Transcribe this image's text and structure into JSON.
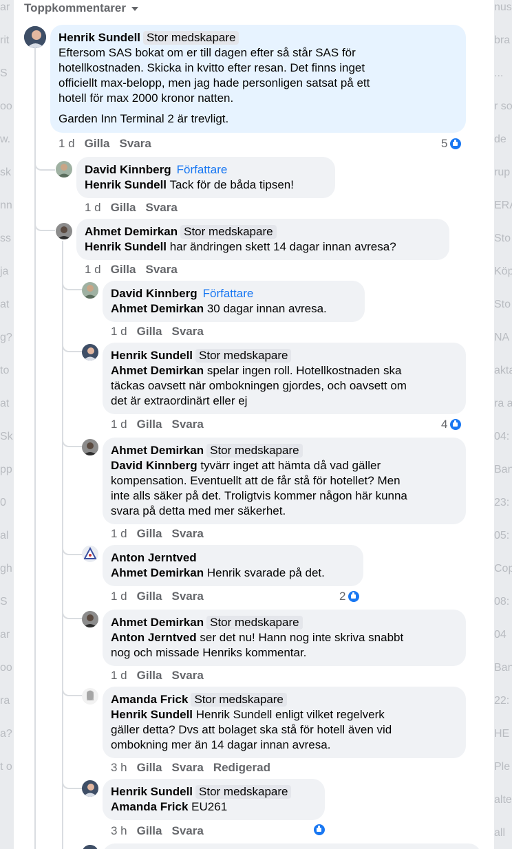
{
  "background_left": [
    "ar",
    "rit",
    "S",
    "oo",
    "w.",
    "sk",
    "nn",
    "ss",
    "ja",
    "at",
    "g?",
    "to",
    "at",
    "Sk",
    "pp",
    "0",
    "al",
    "gh",
    "S",
    "ar",
    "oo",
    "ra",
    "a?",
    "t o"
  ],
  "background_right": [
    "nus",
    "bra",
    "...",
    "r so",
    "de",
    "rup",
    "ERA",
    "Sto",
    "Köp",
    "Sto",
    "NA",
    "akta",
    "ra am",
    "04:",
    "Ban",
    "23:",
    "05:",
    "Cop",
    "08:",
    "04",
    "Ban",
    "22:",
    "HE",
    "Ple",
    "alte",
    "all"
  ],
  "sort": {
    "label": "Toppkommentarer"
  },
  "comments": [
    {
      "author": "Henrik Sundell",
      "badge": "Stor medskapare",
      "text_lines": [
        "Eftersom SAS bokat om er till dagen efter så står SAS för",
        "hotellkostnaden. Skicka in kvitto efter resan. Det finns inget",
        "officiellt max-belopp, men jag hade personligen satsat på ett",
        "hotell för max 2000 kronor natten."
      ],
      "text2": "Garden Inn Terminal 2 är trevligt.",
      "time": "1 d",
      "like": "Gilla",
      "reply": "Svara",
      "likes": "5"
    },
    {
      "author": "David Kinnberg",
      "badge": "Författare",
      "mention": "Henrik Sundell",
      "text": "Tack för de båda tipsen!",
      "time": "1 d",
      "like": "Gilla",
      "reply": "Svara"
    },
    {
      "author": "Ahmet Demirkan",
      "badge": "Stor medskapare",
      "mention": "Henrik Sundell",
      "text": "har ändringen skett 14 dagar innan avresa?",
      "time": "1 d",
      "like": "Gilla",
      "reply": "Svara"
    },
    {
      "author": "David Kinnberg",
      "badge": "Författare",
      "mention": "Ahmet Demirkan",
      "text": "30 dagar innan avresa.",
      "time": "1 d",
      "like": "Gilla",
      "reply": "Svara"
    },
    {
      "author": "Henrik Sundell",
      "badge": "Stor medskapare",
      "mention": "Ahmet Demirkan",
      "text": "spelar ingen roll. Hotellkostnaden ska",
      "text_lines": [
        "täckas oavsett när ombokningen gjordes, och oavsett om",
        "det är extraordinärt eller ej"
      ],
      "time": "1 d",
      "like": "Gilla",
      "reply": "Svara",
      "likes": "4"
    },
    {
      "author": "Ahmet Demirkan",
      "badge": "Stor medskapare",
      "mention": "David Kinnberg",
      "text": "tyvärr inget att hämta då vad gäller",
      "text_lines": [
        "kompensation. Eventuellt att de får stå för hotellet? Men",
        "inte alls säker på det. Troligtvis kommer någon här kunna",
        "svara på detta med mer säkerhet."
      ],
      "time": "1 d",
      "like": "Gilla",
      "reply": "Svara"
    },
    {
      "author": "Anton Jerntved",
      "mention": "Ahmet Demirkan",
      "text": "Henrik svarade på det.",
      "time": "1 d",
      "like": "Gilla",
      "reply": "Svara",
      "likes": "2"
    },
    {
      "author": "Ahmet Demirkan",
      "badge": "Stor medskapare",
      "mention": "Anton Jerntved",
      "text": "ser det nu! Hann nog inte skriva snabbt",
      "text_lines": [
        "nog och missade Henriks kommentar."
      ],
      "time": "1 d",
      "like": "Gilla",
      "reply": "Svara"
    },
    {
      "author": "Amanda Frick",
      "badge": "Stor medskapare",
      "mention": "Henrik Sundell",
      "text": "Henrik Sundell enligt vilket regelverk",
      "text_lines": [
        "gäller detta? Dvs att bolaget ska stå för hotell även vid",
        "ombokning mer än 14 dagar innan avresa."
      ],
      "time": "3 h",
      "like": "Gilla",
      "reply": "Svara",
      "edited": "Redigerad"
    },
    {
      "author": "Henrik Sundell",
      "badge": "Stor medskapare",
      "mention": "Amanda Frick",
      "text": "EU261",
      "time": "3 h",
      "like": "Gilla",
      "reply": "Svara"
    }
  ],
  "colors": {
    "link_blue": "#1877f2",
    "bubble": "#f0f2f5",
    "highlight": "#e7f3ff"
  }
}
